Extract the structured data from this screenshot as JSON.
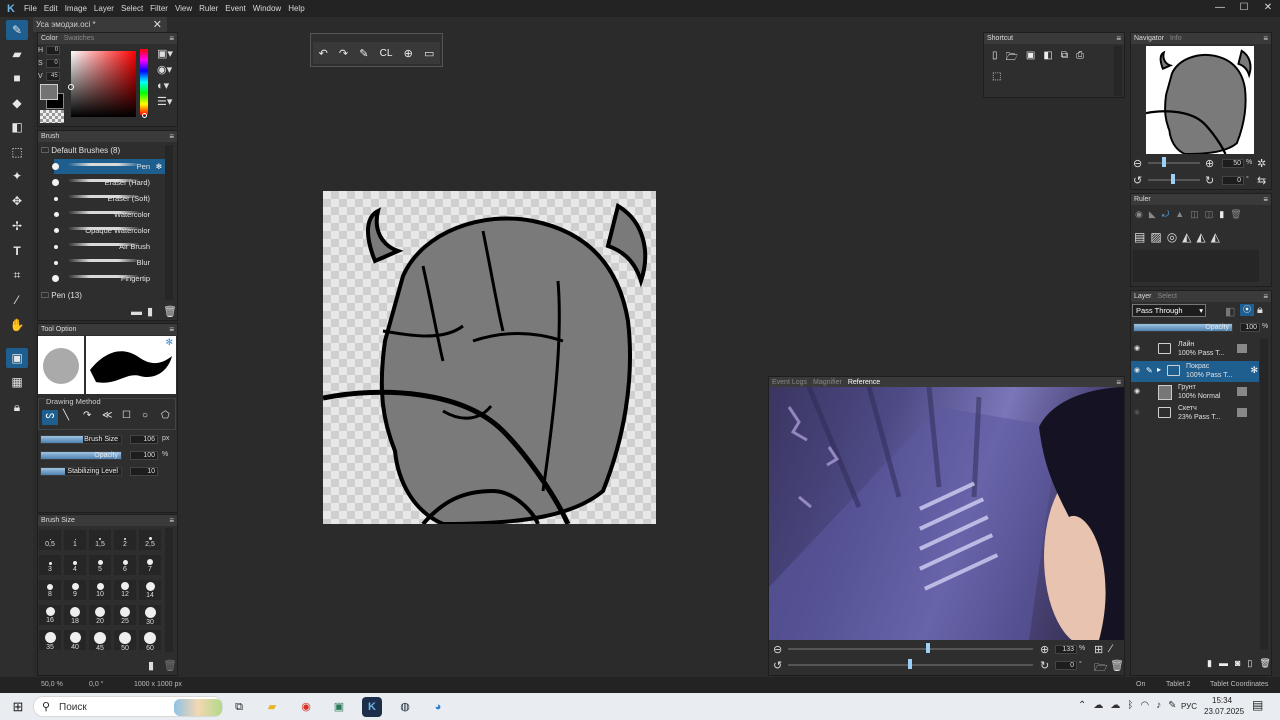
{
  "app": {
    "logo": "K",
    "menu": [
      "File",
      "Edit",
      "Image",
      "Layer",
      "Select",
      "Filter",
      "View",
      "Ruler",
      "Event",
      "Window",
      "Help"
    ],
    "window_controls": [
      "—",
      "☐",
      "✕"
    ]
  },
  "document": {
    "tab_title": "Уса эмодзи.oci *",
    "close": "✕"
  },
  "color_panel": {
    "tab_active": "Color",
    "tab_inactive": "Swatches",
    "h_label": "H",
    "h_value": "0",
    "s_label": "S",
    "s_value": "0",
    "v_label": "V",
    "v_value": "45",
    "foreground": "#737373",
    "background": "#000000"
  },
  "brush_panel": {
    "title": "Brush",
    "group": "Default Brushes (8)",
    "items": [
      "Pen",
      "Eraser (Hard)",
      "Eraser (Soft)",
      "Watercolor",
      "Opaque Watercolor",
      "Air Brush",
      "Blur",
      "Fingertip"
    ],
    "selected": "Pen",
    "group2": "Pen (13)"
  },
  "tool_option": {
    "title": "Tool Option",
    "drawing_method": "Drawing Method",
    "brush_size_label": "Brush Size",
    "brush_size": "106",
    "brush_size_unit": "px",
    "brush_size_level": 0.53,
    "opacity_label": "Opacity",
    "opacity": "100",
    "opacity_unit": "%",
    "opacity_level": 1.0,
    "stabilizing_label": "Stabilizing Level",
    "stabilizing": "10",
    "stabilizing_level": 0.3
  },
  "brush_size_panel": {
    "title": "Brush Size",
    "sizes": [
      "0,5",
      "1",
      "1,5",
      "2",
      "2,5",
      "3",
      "4",
      "5",
      "6",
      "7",
      "8",
      "9",
      "10",
      "12",
      "14",
      "16",
      "18",
      "20",
      "25",
      "30",
      "35",
      "40",
      "45",
      "50",
      "60"
    ]
  },
  "shortcut_panel": {
    "title": "Shortcut"
  },
  "navigator": {
    "tab_active": "Navigator",
    "tab_inactive": "Info",
    "zoom": "50",
    "zoom_unit": "%",
    "rotation": "0",
    "rotation_unit": "°"
  },
  "ruler_panel": {
    "title": "Ruler"
  },
  "layer_panel": {
    "tab_active": "Layer",
    "tab_inactive": "Select",
    "blend_mode": "Pass Through",
    "opacity_label": "Opacity",
    "opacity": "100",
    "opacity_unit": "%",
    "layers": [
      {
        "name": "Лайн",
        "info": "100% Pass T..."
      },
      {
        "name": "Покрас",
        "info": "100% Pass T..."
      },
      {
        "name": "Грунт",
        "info": "100% Normal"
      },
      {
        "name": "Скетч",
        "info": "23% Pass T..."
      }
    ]
  },
  "reference_panel": {
    "tabs": [
      "Event Logs",
      "Magnifier",
      "Reference"
    ],
    "active_tab": "Reference",
    "zoom": "133",
    "zoom_unit": "%",
    "rotation": "0",
    "rotation_unit": "°"
  },
  "status_bar": {
    "zoom": "50,0 %",
    "angle": "0,0 °",
    "size": "1000 x 1000 px",
    "on": "On",
    "tablet": "Tablet 2",
    "tablet_coords": "Tablet Coordinates"
  },
  "taskbar": {
    "search": "Поиск",
    "lang": "РУС",
    "time": "15:34",
    "date": "23.07.2025"
  }
}
